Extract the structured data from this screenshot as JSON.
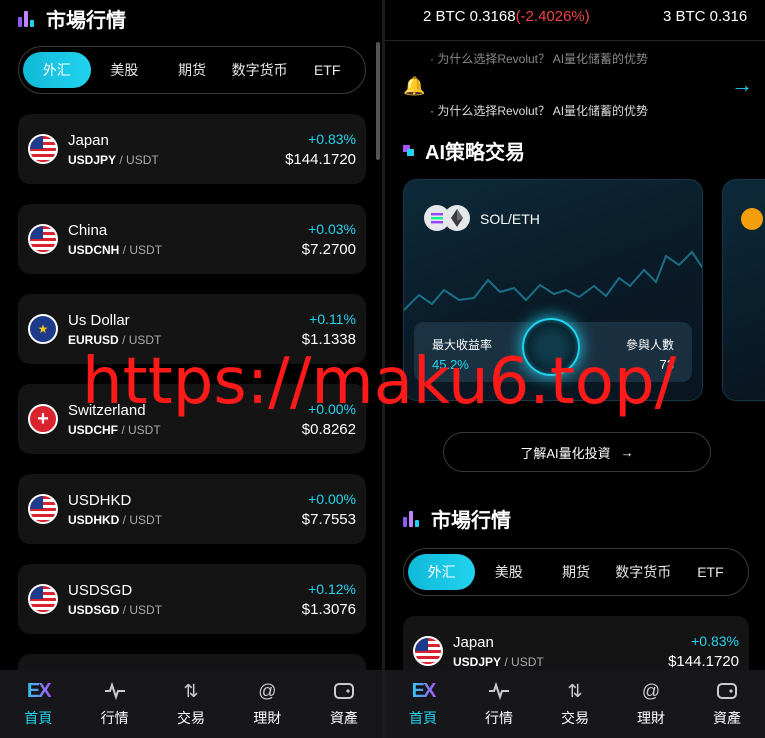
{
  "left": {
    "title": "市場行情",
    "tabs": [
      "外汇",
      "美股",
      "期货",
      "数字货币",
      "ETF"
    ],
    "markets": [
      {
        "name": "Japan",
        "pair": "USDJPY",
        "quote": "USDT",
        "change": "+0.83%",
        "price": "$144.1720",
        "flag": "us"
      },
      {
        "name": "China",
        "pair": "USDCNH",
        "quote": "USDT",
        "change": "+0.03%",
        "price": "$7.2700",
        "flag": "us"
      },
      {
        "name": "Us Dollar",
        "pair": "EURUSD",
        "quote": "USDT",
        "change": "+0.11%",
        "price": "$1.1338",
        "flag": "eu"
      },
      {
        "name": "Switzerland",
        "pair": "USDCHF",
        "quote": "USDT",
        "change": "+0.00%",
        "price": "$0.8262",
        "flag": "ch"
      },
      {
        "name": "USDHKD",
        "pair": "USDHKD",
        "quote": "USDT",
        "change": "+0.00%",
        "price": "$7.7553",
        "flag": "us"
      },
      {
        "name": "USDSGD",
        "pair": "USDSGD",
        "quote": "USDT",
        "change": "+0.12%",
        "price": "$1.3076",
        "flag": "us"
      }
    ]
  },
  "nav": [
    {
      "label": "首頁",
      "icon": "ex-logo-icon",
      "active": true
    },
    {
      "label": "行情",
      "icon": "pulse-icon",
      "active": false
    },
    {
      "label": "交易",
      "icon": "swap-arrows-icon",
      "active": false
    },
    {
      "label": "理財",
      "icon": "at-circle-icon",
      "active": false
    },
    {
      "label": "資產",
      "icon": "wallet-icon",
      "active": false
    }
  ],
  "right": {
    "ticker_a": "2 BTC 0.3168",
    "ticker_a_change": "(-2.4026%)",
    "ticker_b": "3 BTC 0.316",
    "notice_1": "· 为什么选择Revolut？ AI量化储蓄的优势",
    "notice_2": "· 为什么选择Revolut？ AI量化储蓄的优势",
    "ai_title": "AI策略交易",
    "ai_pair": "SOL/ETH",
    "max_yield_label": "最大收益率",
    "max_yield_value": "45.2%",
    "participants_label": "參與人數",
    "participants_value": "73",
    "learn_button": "了解AI量化投資",
    "market_title": "市場行情",
    "tabs": [
      "外汇",
      "美股",
      "期货",
      "数字货币",
      "ETF"
    ],
    "first_market": {
      "name": "Japan",
      "pair": "USDJPY",
      "quote": "USDT",
      "change": "+0.83%",
      "price": "$144.1720"
    }
  },
  "watermark": "https://maku6.top/",
  "colors": {
    "accent": "#22d3ee",
    "negative": "#ef4444",
    "card": "#141414",
    "nav": "#17171b"
  }
}
